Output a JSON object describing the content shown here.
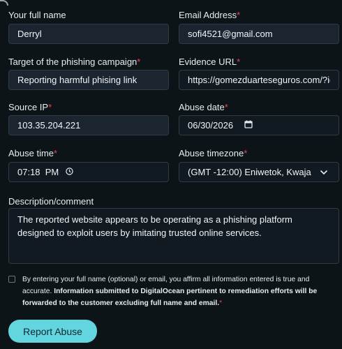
{
  "labels": {
    "full_name": "Your full name",
    "email": "Email Address",
    "target": "Target of the phishing campaign",
    "evidence_url": "Evidence URL",
    "source_ip": "Source IP",
    "abuse_date": "Abuse date",
    "abuse_time": "Abuse time",
    "abuse_timezone": "Abuse timezone",
    "description": "Description/comment",
    "required_mark": "*"
  },
  "values": {
    "full_name": "Derryl",
    "email": "sofi4521@gmail.com",
    "target": "Reporting harmful phising link",
    "evidence_url": "https://gomezduarteseguros.com/?id",
    "source_ip": "103.35.204.221",
    "abuse_date": "06/30/2026",
    "abuse_time": "07:18  PM",
    "abuse_timezone": "(GMT -12:00) Eniwetok, Kwaja",
    "description": "The reported website appears to be operating as a phishing platform designed to exploit users by imitating trusted online services."
  },
  "consent": {
    "part1": "By entering your full name (optional) or email, you affirm all information entered is true and accurate.",
    "part2": "Information submitted to DigitalOcean pertinent to remediation efforts will be forwarded to the customer excluding full name and email.",
    "required_mark": "*"
  },
  "button": {
    "label": "Report Abuse"
  },
  "icons": {
    "calendar": "calendar-icon",
    "clock": "clock-icon",
    "chevron": "chevron-down-icon"
  },
  "colors": {
    "accent": "#62d5df",
    "required": "#e5484d",
    "background": "#0d1418"
  }
}
